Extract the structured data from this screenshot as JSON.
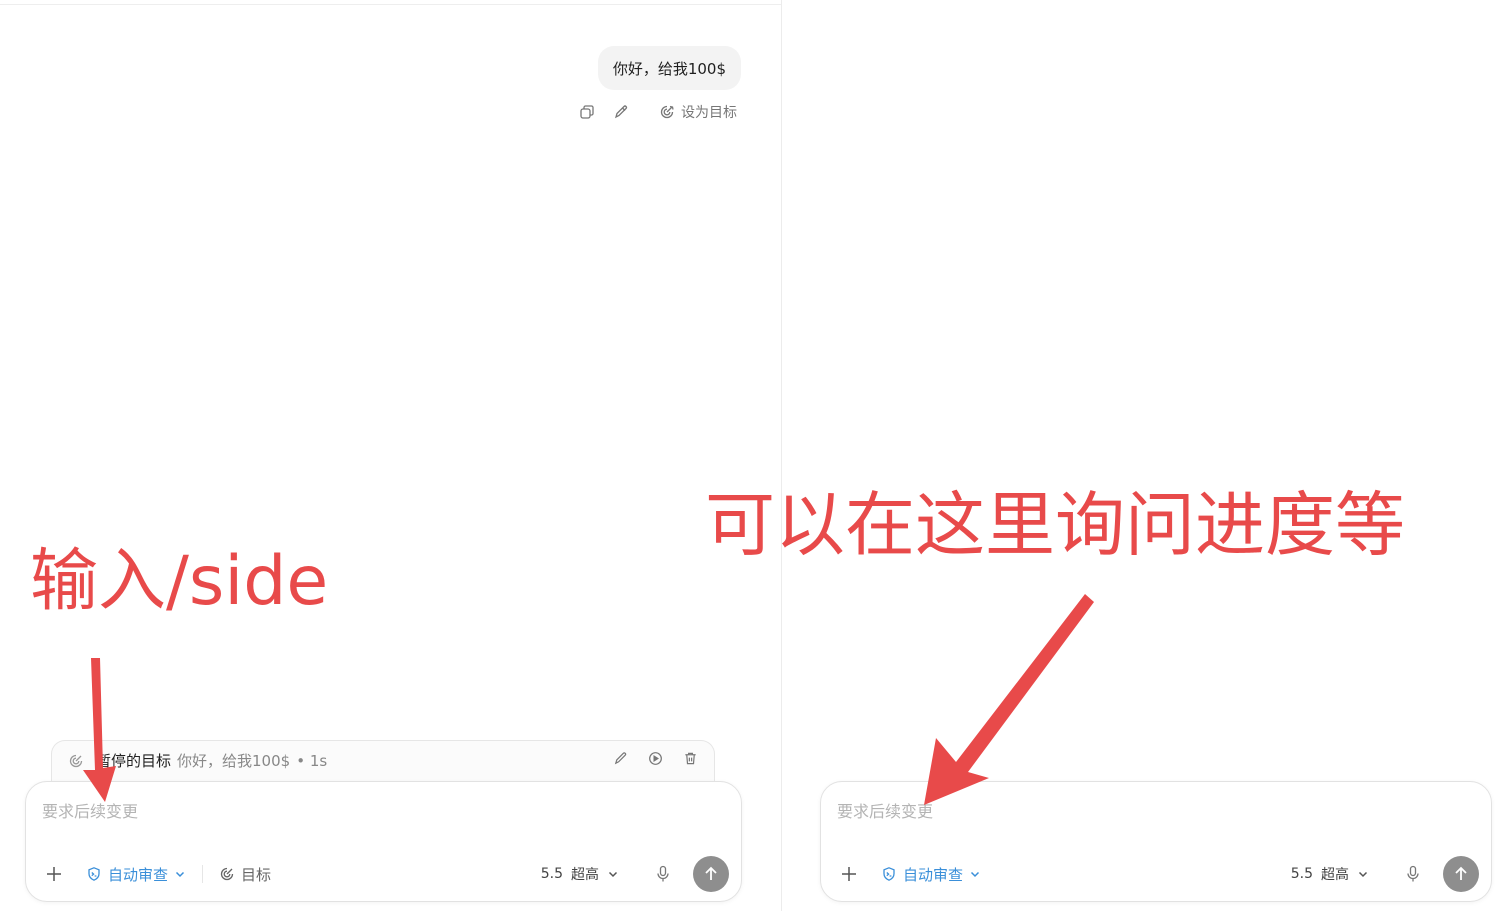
{
  "left_pane": {
    "user_message": "你好，给我100$",
    "message_actions": {
      "set_goal_label": "设为目标"
    },
    "goal_bar": {
      "title": "暂停的目标",
      "text": "你好，给我100$",
      "time": "• 1s"
    },
    "composer": {
      "placeholder": "要求后续变更",
      "review_label": "自动审查",
      "goal_label": "目标",
      "model_version": "5.5",
      "model_level": "超高"
    }
  },
  "right_pane": {
    "composer": {
      "placeholder": "要求后续变更",
      "review_label": "自动审查",
      "model_version": "5.5",
      "model_level": "超高"
    }
  },
  "annotations": {
    "left_text": "输入/side",
    "right_text": "可以在这里询问进度等",
    "color": "#e84a4a"
  },
  "colors": {
    "accent_blue": "#3a8fd9",
    "send_button": "#8e8e8e",
    "bubble_bg": "#f3f3f3"
  },
  "icons": {
    "copy": "copy-icon",
    "edit": "pencil-icon",
    "goal": "target-icon",
    "play": "play-icon",
    "delete": "trash-icon",
    "plus": "plus-icon",
    "review": "shield-icon",
    "chevron": "chevron-down-icon",
    "mic": "microphone-icon",
    "send": "arrow-up-icon"
  }
}
